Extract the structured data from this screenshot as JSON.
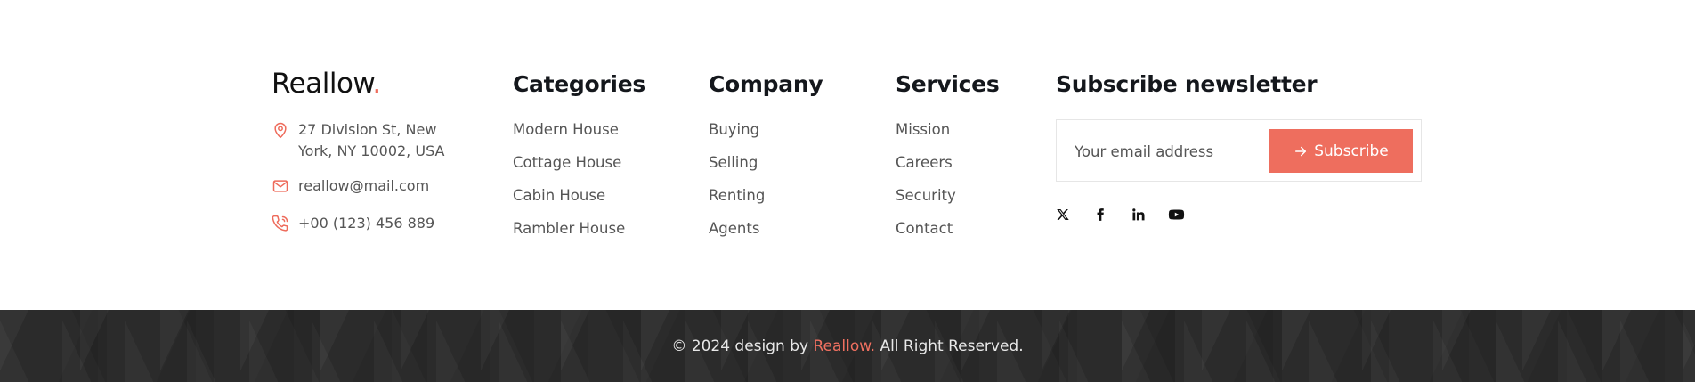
{
  "brand": {
    "name": "Reallow",
    "dot": ".",
    "accent_color": "#ee6e5e"
  },
  "contact": {
    "address": "27 Division St, New York, NY 10002, USA",
    "email": "reallow@mail.com",
    "phone": "+00 (123) 456 889",
    "icons": {
      "address": "map-pin-icon",
      "email": "mail-icon",
      "phone": "phone-icon"
    }
  },
  "columns": [
    {
      "title": "Categories",
      "links": [
        "Modern House",
        "Cottage House",
        "Cabin House",
        "Rambler House"
      ]
    },
    {
      "title": "Company",
      "links": [
        "Buying",
        "Selling",
        "Renting",
        "Agents"
      ]
    },
    {
      "title": "Services",
      "links": [
        "Mission",
        "Careers",
        "Security",
        "Contact"
      ]
    }
  ],
  "newsletter": {
    "title": "Subscribe newsletter",
    "placeholder": "Your email address",
    "button_label": "Subscribe",
    "button_icon": "arrow-right-icon"
  },
  "socials": [
    "x-icon",
    "facebook-icon",
    "linkedin-icon",
    "youtube-icon"
  ],
  "bottom": {
    "prefix": "© 2024 design by",
    "brand": "Reallow.",
    "suffix": "All Right Reserved.",
    "background": "#2b2b2b"
  }
}
